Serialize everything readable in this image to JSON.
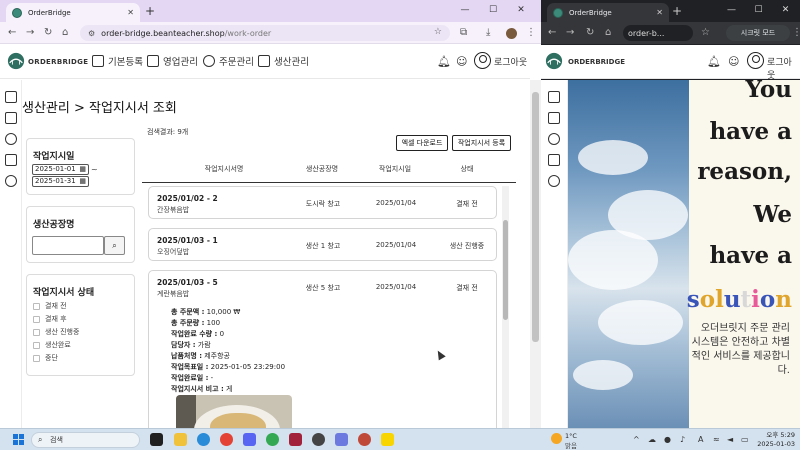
{
  "left_browser": {
    "tab_title": "OrderBridge",
    "url_host": "order-bridge.beanteacher.shop",
    "url_path": "/work-order"
  },
  "app": {
    "logo_text": "ORDERBRIDGE",
    "nav": [
      "기본등록",
      "영업관리",
      "주문관리",
      "생산관리"
    ],
    "logout": "로그아웃"
  },
  "page": {
    "title": "생산관리 > 작업지시서 조회",
    "result_count": "검색결과: 9개",
    "excel_btn": "엑셀 다운로드",
    "register_btn": "작업지시서 등록"
  },
  "filters": {
    "date_title": "작업지시일",
    "date_from": "2025-01-01",
    "date_to": "2025-01-31",
    "date_sep": "~",
    "factory_title": "생산공장명",
    "status_title": "작업지시서 상태",
    "status_options": [
      "결재 전",
      "결재 후",
      "생산 진행중",
      "생산완료",
      "중단"
    ]
  },
  "table": {
    "headers": [
      "작업지시서명",
      "생산공장명",
      "작업지시일",
      "상태"
    ],
    "rows": [
      {
        "title": "2025/01/02 - 2",
        "product": "간장볶음밥",
        "factory": "도시락 창고",
        "date": "2025/01/04",
        "status": "결재 전"
      },
      {
        "title": "2025/01/03 - 1",
        "product": "오징어덮밥",
        "factory": "생산 1 창고",
        "date": "2025/01/04",
        "status": "생산 진행중"
      },
      {
        "title": "2025/01/03 - 5",
        "product": "계란볶음밥",
        "factory": "생산 5 창고",
        "date": "2025/01/04",
        "status": "결재 전"
      }
    ],
    "expanded": {
      "total_amount_label": "총 주문액 :",
      "total_amount": "10,000 ₩",
      "total_qty_label": "총 주문량 :",
      "total_qty": "100",
      "done_qty_label": "작업완료 수량 :",
      "done_qty": "0",
      "manager_label": "담당자 :",
      "manager": "가람",
      "destination_label": "납품처명 :",
      "destination": "제주항공",
      "target_label": "작업목표일 :",
      "target": "2025-01-05 23:29:00",
      "done_date_label": "작업완료일 :",
      "done_date": "-",
      "note_label": "작업지시서 비고 :",
      "note": "게"
    }
  },
  "right_browser": {
    "tab_title": "OrderBridge",
    "url_text": "order-b...",
    "incognito": "시크릿 모드",
    "logo_text": "ORDERBRIDGE",
    "logout": "로그아웃",
    "hero_lines": [
      "You",
      "have a",
      "reason,",
      "We",
      "have a"
    ],
    "hero_solution_letters": [
      "s",
      "o",
      "l",
      "u",
      "t",
      "i",
      "o",
      "n"
    ],
    "hero_solution_colors": [
      "#3a55b8",
      "#e0a52c",
      "#e0a52c",
      "#3a55b8",
      "#d8d8d8",
      "#e85a9a",
      "#3a55b8",
      "#e0a52c"
    ],
    "hero_desc": "오더브릿지 주문 관리 시스템은 안전하고 차별적인 서비스를 제공합니다."
  },
  "taskbar": {
    "search": "검색",
    "weather_temp": "1°C",
    "weather_desc": "맑음",
    "time": "오후 5:29",
    "date": "2025-01-03"
  }
}
